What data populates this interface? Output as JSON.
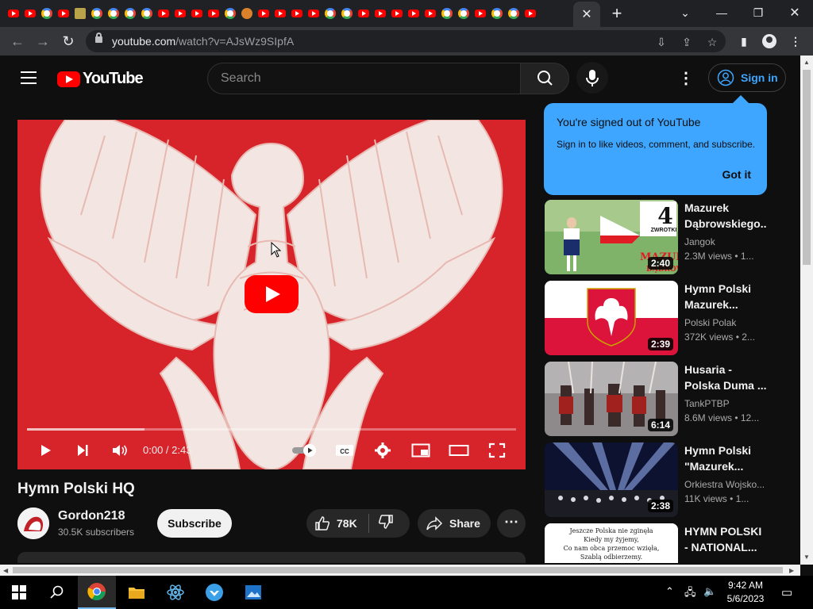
{
  "browser": {
    "url_host": "youtube.com",
    "url_path": "/watch?v=AJsWz9SIpfA",
    "tab_favicons": [
      "youtube",
      "youtube",
      "google",
      "youtube",
      "image",
      "google",
      "google",
      "google",
      "google",
      "youtube",
      "youtube",
      "youtube",
      "youtube",
      "google",
      "food",
      "youtube",
      "youtube",
      "youtube",
      "youtube",
      "google",
      "google",
      "youtube",
      "youtube",
      "youtube",
      "youtube",
      "youtube",
      "google",
      "google",
      "youtube",
      "google",
      "google",
      "youtube"
    ]
  },
  "header": {
    "logo_text": "YouTube",
    "search_placeholder": "Search",
    "signin_label": "Sign in"
  },
  "player": {
    "current_time": "0:00 / 2:43",
    "progress_fraction": 0.24,
    "played_fraction": 0.0
  },
  "video": {
    "title": "Hymn Polski HQ",
    "channel": "Gordon218",
    "subscribers": "30.5K subscribers",
    "subscribe_label": "Subscribe",
    "likes": "78K",
    "share_label": "Share"
  },
  "popup": {
    "title": "You're signed out of YouTube",
    "body": "Sign in to like videos, comment, and subscribe.",
    "action": "Got it"
  },
  "related": [
    {
      "title": "Mazurek Dąbrowskiego...",
      "channel": "Jangok",
      "meta": "2.3M views  •  1...",
      "duration": "2:40",
      "thumb_text_1": "4",
      "thumb_text_2": "ZWROTKI",
      "thumb_text_3": "MAZUREK",
      "thumb_text_4": "DĄBROWS"
    },
    {
      "title": "Hymn Polski Mazurek...",
      "channel": "Polski Polak",
      "meta": "372K views  •  2...",
      "duration": "2:39"
    },
    {
      "title": "Husaria - Polska Duma ...",
      "channel": "TankPTBP",
      "meta": "8.6M views  •  12...",
      "duration": "6:14"
    },
    {
      "title": "Hymn Polski \"Mazurek...",
      "channel": "Orkiestra Wojsko...",
      "meta": "11K views  •  1...",
      "duration": "2:38"
    },
    {
      "title": "HYMN POLSKI - NATIONAL...",
      "channel": "",
      "meta": "",
      "duration": "",
      "thumb_lines": [
        "Jeszcze Polska nie zginęła",
        "Kiedy my żyjemy,",
        "Co nam obca przemoc wzięła,",
        "Szablą odbierzemy."
      ]
    }
  ],
  "taskbar": {
    "time": "9:42 AM",
    "date": "5/6/2023"
  },
  "colors": {
    "yt_red": "#ff0000",
    "accent_blue": "#3ea6ff",
    "bg": "#0f0f0f"
  }
}
